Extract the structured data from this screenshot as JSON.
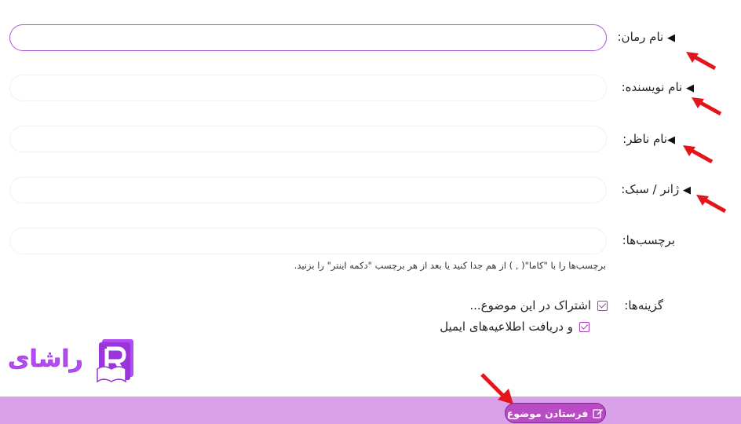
{
  "form": {
    "fields": [
      {
        "label": "نام رمان:",
        "marker": "◀"
      },
      {
        "label": "نام نویسنده:",
        "marker": "◀"
      },
      {
        "label": "نام ناظر:",
        "marker": "◀"
      },
      {
        "label": "ژانر / سبک:",
        "marker": "◀"
      },
      {
        "label": "برچسب‌ها:",
        "marker": ""
      }
    ],
    "tags_help": "برچسب‌ها را با \"کاما\"( , ) از هم جدا کنید یا بعد از هر برچسب \"دکمه اینتر\" را بزنید.",
    "options_label": "گزینه‌ها:",
    "options": [
      {
        "label": "اشتراک در این موضوع...",
        "checked": true
      },
      {
        "label": "و دریافت اطلاعیه‌های ایمیل",
        "checked": true
      }
    ]
  },
  "submit": {
    "label": "فرستادن موضوع",
    "icon": "edit-icon"
  },
  "logo": {
    "text": "راشای",
    "icon": "book-r-icon"
  },
  "colors": {
    "accent": "#b94bc4",
    "footer": "#d9a1ea",
    "arrow": "#e3141c",
    "logo": "#b24bf0"
  }
}
